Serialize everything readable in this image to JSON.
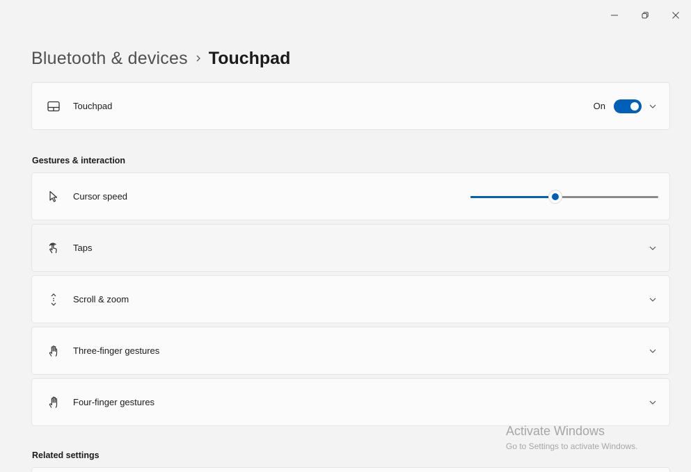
{
  "window": {
    "caption": {
      "minimize_icon": "minimize-icon",
      "restore_icon": "restore-icon",
      "close_icon": "close-icon"
    }
  },
  "breadcrumb": {
    "parent": "Bluetooth & devices",
    "separator_icon": "chevron-right-icon",
    "current": "Touchpad"
  },
  "touchpad_card": {
    "label": "Touchpad",
    "icon": "touchpad-icon",
    "toggle_state": "On",
    "toggle_on": true
  },
  "gestures_section": {
    "title": "Gestures & interaction",
    "items": [
      {
        "label": "Cursor speed",
        "icon": "cursor-icon",
        "control": "slider",
        "value_fraction": 0.45
      },
      {
        "label": "Taps",
        "icon": "tap-icon",
        "control": "expander"
      },
      {
        "label": "Scroll & zoom",
        "icon": "scroll-icon",
        "control": "expander"
      },
      {
        "label": "Three-finger gestures",
        "icon": "three-finger-hand-icon",
        "control": "expander"
      },
      {
        "label": "Four-finger gestures",
        "icon": "four-finger-hand-icon",
        "control": "expander"
      }
    ]
  },
  "related_section": {
    "title": "Related settings"
  },
  "watermark": {
    "title": "Activate Windows",
    "subtitle": "Go to Settings to activate Windows."
  },
  "colors": {
    "accent": "#005fb8",
    "background": "#f3f3f3",
    "card": "#fbfbfb"
  }
}
